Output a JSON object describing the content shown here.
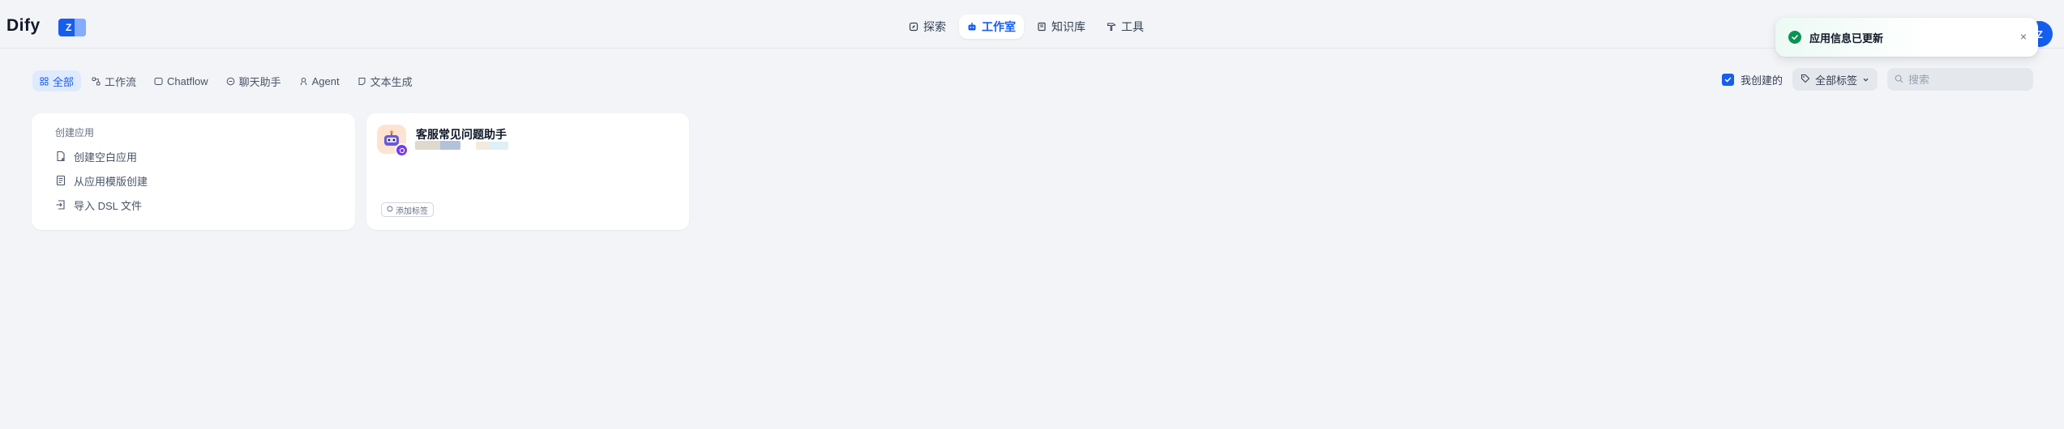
{
  "header": {
    "logo": "Dify",
    "workspace_initial": "Z",
    "nav": [
      {
        "label": "探索",
        "icon": "compass-icon",
        "active": false
      },
      {
        "label": "工作室",
        "icon": "robot-icon",
        "active": true
      },
      {
        "label": "知识库",
        "icon": "book-icon",
        "active": false
      },
      {
        "label": "工具",
        "icon": "hammer-icon",
        "active": false
      }
    ],
    "avatar_initial": "Z"
  },
  "toast": {
    "message": "应用信息已更新",
    "status": "success",
    "close": "×"
  },
  "filters": {
    "tabs": [
      {
        "label": "全部",
        "icon": "grid-icon",
        "active": true
      },
      {
        "label": "工作流",
        "icon": "workflow-icon",
        "active": false
      },
      {
        "label": "Chatflow",
        "icon": "chatflow-icon",
        "active": false
      },
      {
        "label": "聊天助手",
        "icon": "chat-icon",
        "active": false
      },
      {
        "label": "Agent",
        "icon": "agent-icon",
        "active": false
      },
      {
        "label": "文本生成",
        "icon": "text-gen-icon",
        "active": false
      }
    ],
    "mine_label": "我创建的",
    "mine_checked": true,
    "tag_filter_label": "全部标签",
    "search_placeholder": "搜索"
  },
  "create_card": {
    "title": "创建应用",
    "items": [
      {
        "label": "创建空白应用",
        "icon": "file-plus-icon"
      },
      {
        "label": "从应用模版创建",
        "icon": "template-icon"
      },
      {
        "label": "导入 DSL 文件",
        "icon": "import-icon"
      }
    ]
  },
  "apps": [
    {
      "name": "客服常见问题助手",
      "add_tag_label": "添加标签"
    }
  ],
  "colors": {
    "accent": "#155eef",
    "background": "#f2f4f7",
    "success": "#079455"
  }
}
